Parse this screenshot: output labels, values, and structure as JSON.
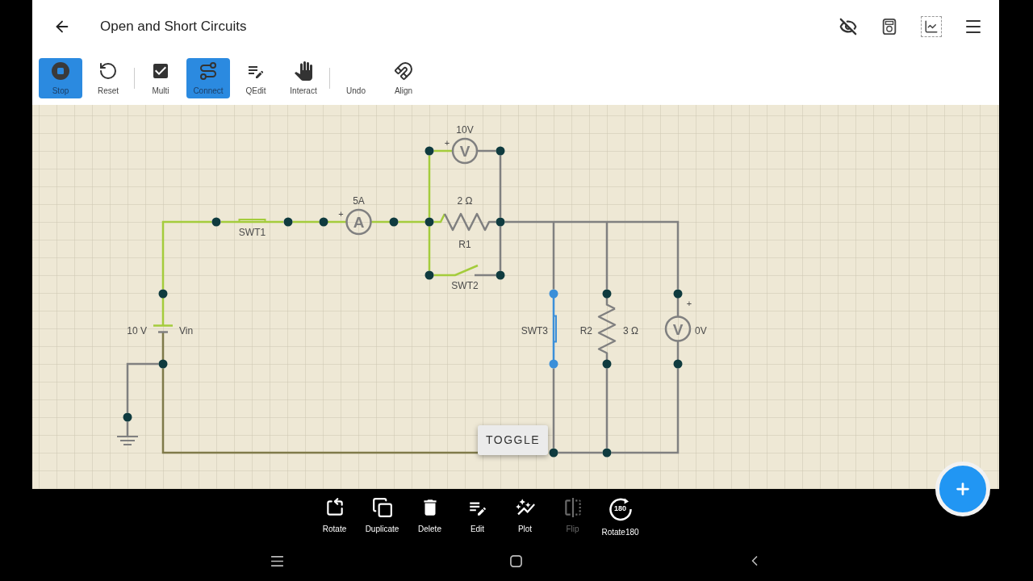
{
  "header": {
    "title": "Open and Short Circuits"
  },
  "toolbar": [
    {
      "label": "Stop",
      "selected": true
    },
    {
      "label": "Reset",
      "selected": false
    },
    {
      "label": "Multi",
      "selected": false
    },
    {
      "label": "Connect",
      "selected": true
    },
    {
      "label": "QEdit",
      "selected": false
    },
    {
      "label": "Interact",
      "selected": false
    },
    {
      "label": "Undo",
      "selected": false
    },
    {
      "label": "Align",
      "selected": false
    }
  ],
  "circuit": {
    "components": [
      {
        "kind": "voltmeter",
        "symbol": "V",
        "polarity": "+",
        "reading": "10V"
      },
      {
        "kind": "switch",
        "label": "SWT1",
        "closed": true,
        "selected": false
      },
      {
        "kind": "ammeter",
        "symbol": "A",
        "polarity": "+",
        "reading": "5A"
      },
      {
        "kind": "resistor",
        "label": "R1",
        "value": "2 Ω"
      },
      {
        "kind": "switch",
        "label": "SWT2",
        "closed": false,
        "selected": false
      },
      {
        "kind": "battery",
        "label": "Vin",
        "value": "10 V"
      },
      {
        "kind": "switch",
        "label": "SWT3",
        "closed": true,
        "selected": true
      },
      {
        "kind": "resistor",
        "label": "R2",
        "value": "3 Ω"
      },
      {
        "kind": "voltmeter",
        "symbol": "V",
        "polarity": "+",
        "reading": "0V"
      },
      {
        "kind": "ground"
      }
    ],
    "popup": {
      "label": "TOGGLE"
    }
  },
  "bottom_toolbar": [
    {
      "label": "Rotate",
      "disabled": false
    },
    {
      "label": "Duplicate",
      "disabled": false
    },
    {
      "label": "Delete",
      "disabled": false
    },
    {
      "label": "Edit",
      "disabled": false
    },
    {
      "label": "Plot",
      "disabled": false
    },
    {
      "label": "Flip",
      "disabled": true
    },
    {
      "label": "Rotate180",
      "disabled": false,
      "badge": "180"
    }
  ]
}
